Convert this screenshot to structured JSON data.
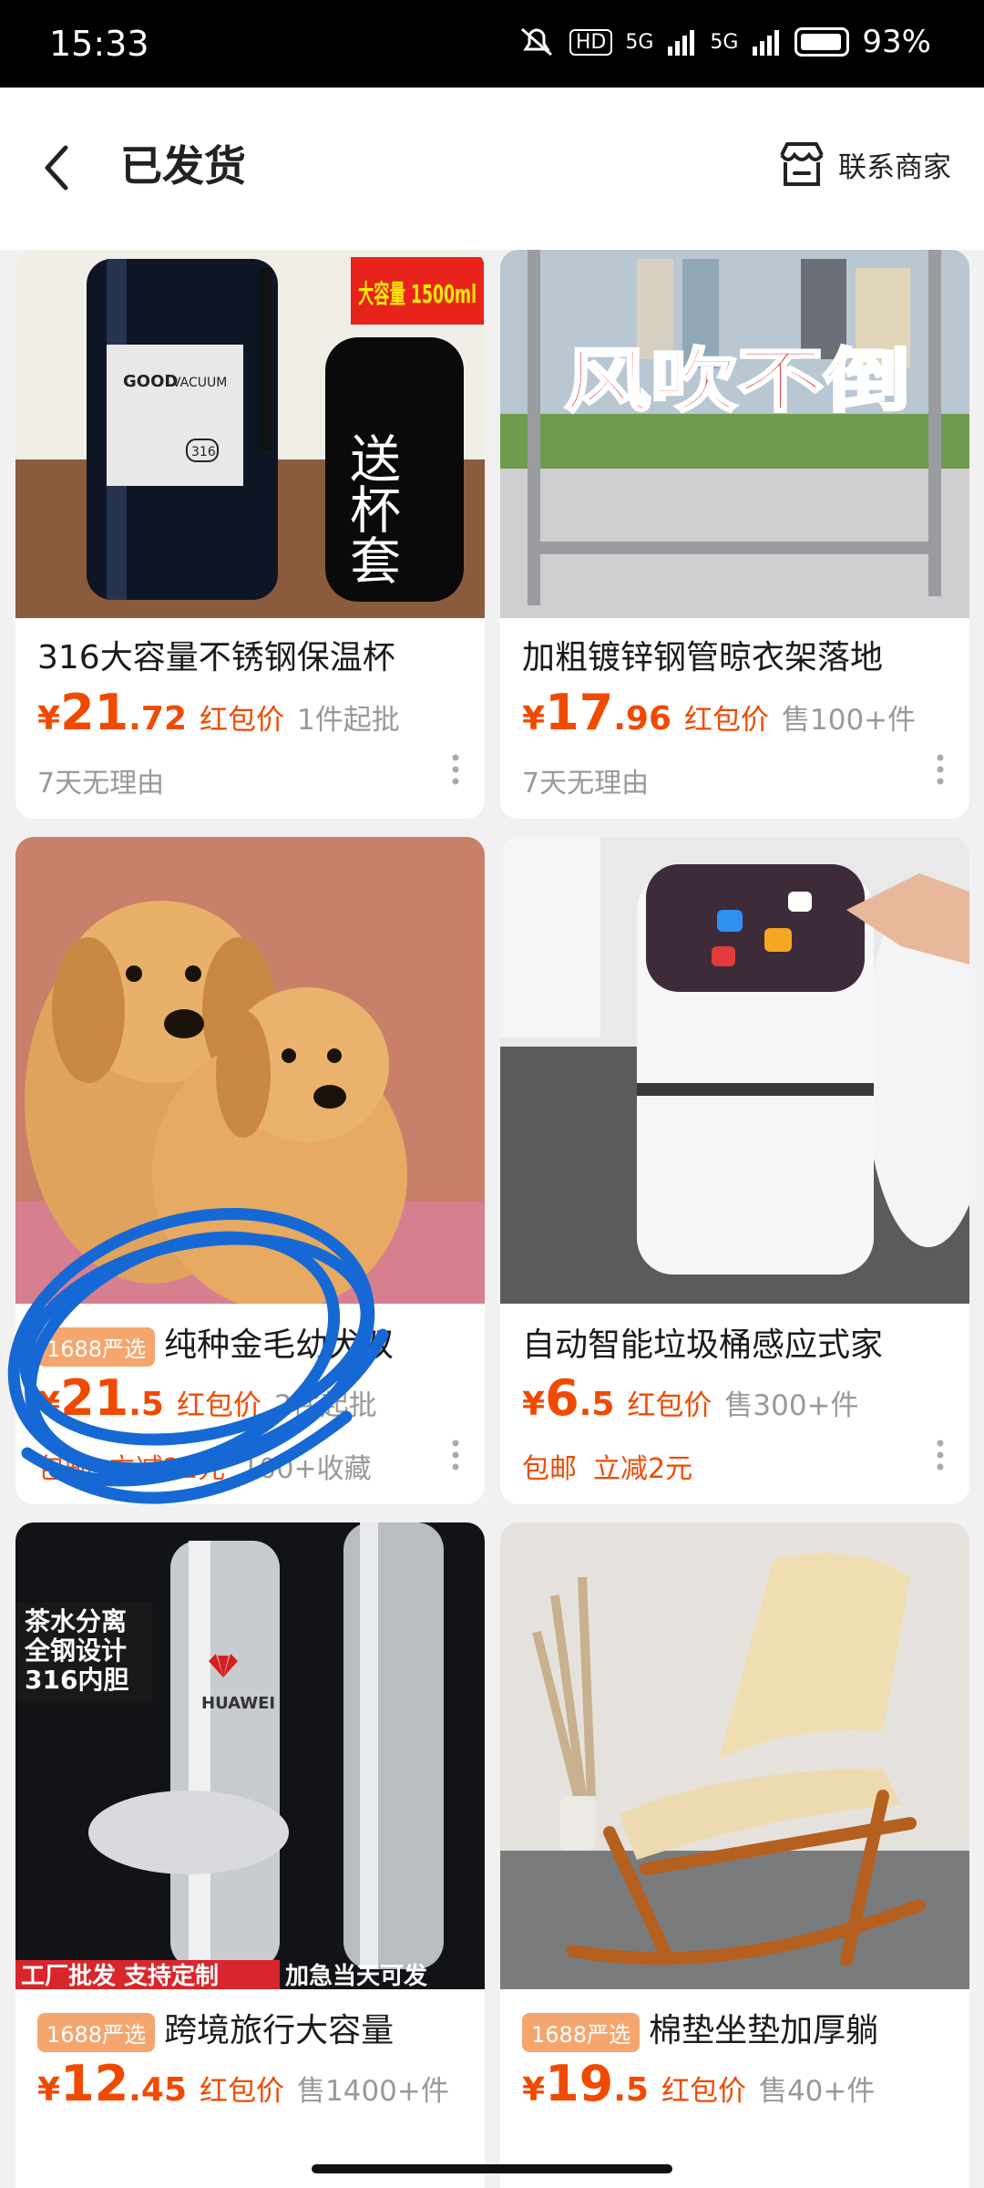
{
  "status_bar": {
    "time": "15:33",
    "hd": "HD",
    "net1": "5G",
    "net2": "5G",
    "battery": "93%"
  },
  "header": {
    "title": "已发货",
    "contact_label": "联系商家"
  },
  "image_texts": {
    "cup_badge": "大容量 1500ml",
    "cup_tag": "送杯套",
    "cup_label_top": "GOOD",
    "cup_label_side": "VACUUM",
    "cup_label_num": "316",
    "rack_slogan": "风吹不倒",
    "bottle_line1": "茶水分离",
    "bottle_line2": "全钢设计",
    "bottle_line3": "316内胆",
    "bottle_brand": "HUAWEI",
    "bottle_banner_left": "工厂批发 支持定制",
    "bottle_banner_right": "加急当天可发"
  },
  "products": [
    {
      "title": "316大容量不锈钢保温杯",
      "badge": "",
      "currency": "¥",
      "price_int": "21",
      "price_dec": ".72",
      "price_tag": "红包价",
      "price_extra": "1件起批",
      "meta": "7天无理由",
      "tags": []
    },
    {
      "title": "加粗镀锌钢管晾衣架落地",
      "badge": "",
      "currency": "¥",
      "price_int": "17",
      "price_dec": ".96",
      "price_tag": "红包价",
      "price_extra": "售100+件",
      "meta": "7天无理由",
      "tags": []
    },
    {
      "title": "纯种金毛幼犬双",
      "badge": "1688严选",
      "currency": "¥",
      "price_int": "21",
      "price_dec": ".5",
      "price_tag": "红包价",
      "price_extra": "2件起批",
      "meta": "100+收藏",
      "tags": [
        "包邮",
        "立减21元"
      ]
    },
    {
      "title": "自动智能垃圾桶感应式家",
      "badge": "",
      "currency": "¥",
      "price_int": "6",
      "price_dec": ".5",
      "price_tag": "红包价",
      "price_extra": "售300+件",
      "meta": "",
      "tags": [
        "包邮",
        "立减2元"
      ]
    },
    {
      "title": "跨境旅行大容量",
      "badge": "1688严选",
      "currency": "¥",
      "price_int": "12",
      "price_dec": ".45",
      "price_tag": "红包价",
      "price_extra": "售1400+件",
      "meta": "",
      "tags": []
    },
    {
      "title": "棉垫坐垫加厚躺",
      "badge": "1688严选",
      "currency": "¥",
      "price_int": "19",
      "price_dec": ".5",
      "price_tag": "红包价",
      "price_extra": "售40+件",
      "meta": "",
      "tags": []
    }
  ]
}
